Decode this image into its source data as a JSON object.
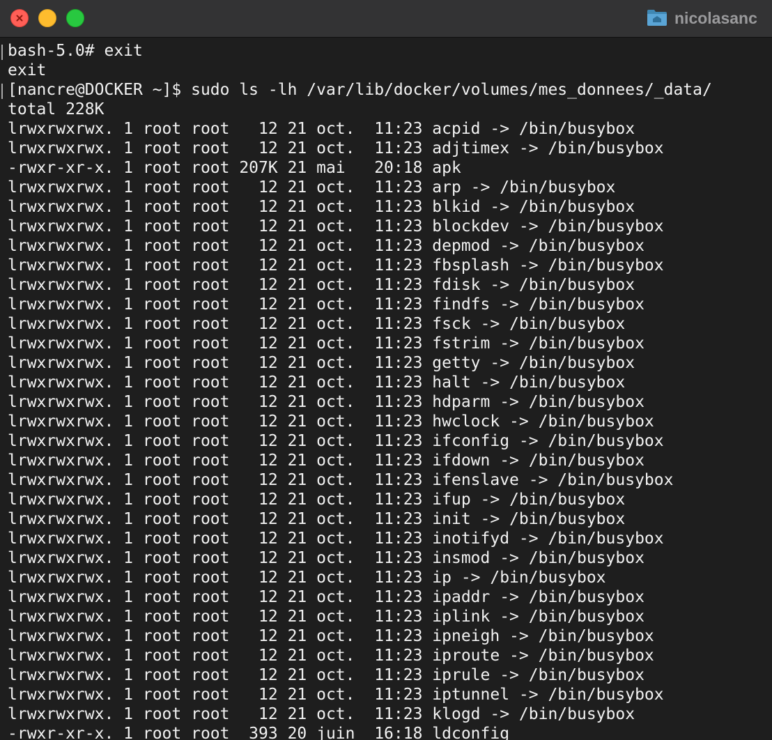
{
  "window": {
    "title": "nicolasanc",
    "controls": {
      "close": "close-icon",
      "minimize": "minimize-icon",
      "zoom": "zoom-icon"
    },
    "title_icon": "folder-icon"
  },
  "colors": {
    "background": "#1e1e1e",
    "titlebar": "#333334",
    "text": "#f2f2f2",
    "title_text": "#9a9a9c",
    "close": "#ff5f57",
    "minimize": "#febc2e",
    "zoom": "#28c840"
  },
  "terminal": {
    "lines": [
      "bash-5.0# exit",
      "exit",
      "[nancre@DOCKER ~]$ sudo ls -lh /var/lib/docker/volumes/mes_donnees/_data/",
      "total 228K",
      "lrwxrwxrwx. 1 root root   12 21 oct.  11:23 acpid -> /bin/busybox",
      "lrwxrwxrwx. 1 root root   12 21 oct.  11:23 adjtimex -> /bin/busybox",
      "-rwxr-xr-x. 1 root root 207K 21 mai   20:18 apk",
      "lrwxrwxrwx. 1 root root   12 21 oct.  11:23 arp -> /bin/busybox",
      "lrwxrwxrwx. 1 root root   12 21 oct.  11:23 blkid -> /bin/busybox",
      "lrwxrwxrwx. 1 root root   12 21 oct.  11:23 blockdev -> /bin/busybox",
      "lrwxrwxrwx. 1 root root   12 21 oct.  11:23 depmod -> /bin/busybox",
      "lrwxrwxrwx. 1 root root   12 21 oct.  11:23 fbsplash -> /bin/busybox",
      "lrwxrwxrwx. 1 root root   12 21 oct.  11:23 fdisk -> /bin/busybox",
      "lrwxrwxrwx. 1 root root   12 21 oct.  11:23 findfs -> /bin/busybox",
      "lrwxrwxrwx. 1 root root   12 21 oct.  11:23 fsck -> /bin/busybox",
      "lrwxrwxrwx. 1 root root   12 21 oct.  11:23 fstrim -> /bin/busybox",
      "lrwxrwxrwx. 1 root root   12 21 oct.  11:23 getty -> /bin/busybox",
      "lrwxrwxrwx. 1 root root   12 21 oct.  11:23 halt -> /bin/busybox",
      "lrwxrwxrwx. 1 root root   12 21 oct.  11:23 hdparm -> /bin/busybox",
      "lrwxrwxrwx. 1 root root   12 21 oct.  11:23 hwclock -> /bin/busybox",
      "lrwxrwxrwx. 1 root root   12 21 oct.  11:23 ifconfig -> /bin/busybox",
      "lrwxrwxrwx. 1 root root   12 21 oct.  11:23 ifdown -> /bin/busybox",
      "lrwxrwxrwx. 1 root root   12 21 oct.  11:23 ifenslave -> /bin/busybox",
      "lrwxrwxrwx. 1 root root   12 21 oct.  11:23 ifup -> /bin/busybox",
      "lrwxrwxrwx. 1 root root   12 21 oct.  11:23 init -> /bin/busybox",
      "lrwxrwxrwx. 1 root root   12 21 oct.  11:23 inotifyd -> /bin/busybox",
      "lrwxrwxrwx. 1 root root   12 21 oct.  11:23 insmod -> /bin/busybox",
      "lrwxrwxrwx. 1 root root   12 21 oct.  11:23 ip -> /bin/busybox",
      "lrwxrwxrwx. 1 root root   12 21 oct.  11:23 ipaddr -> /bin/busybox",
      "lrwxrwxrwx. 1 root root   12 21 oct.  11:23 iplink -> /bin/busybox",
      "lrwxrwxrwx. 1 root root   12 21 oct.  11:23 ipneigh -> /bin/busybox",
      "lrwxrwxrwx. 1 root root   12 21 oct.  11:23 iproute -> /bin/busybox",
      "lrwxrwxrwx. 1 root root   12 21 oct.  11:23 iprule -> /bin/busybox",
      "lrwxrwxrwx. 1 root root   12 21 oct.  11:23 iptunnel -> /bin/busybox",
      "lrwxrwxrwx. 1 root root   12 21 oct.  11:23 klogd -> /bin/busybox",
      "-rwxr-xr-x. 1 root root  393 20 juin  16:18 ldconfig"
    ]
  }
}
